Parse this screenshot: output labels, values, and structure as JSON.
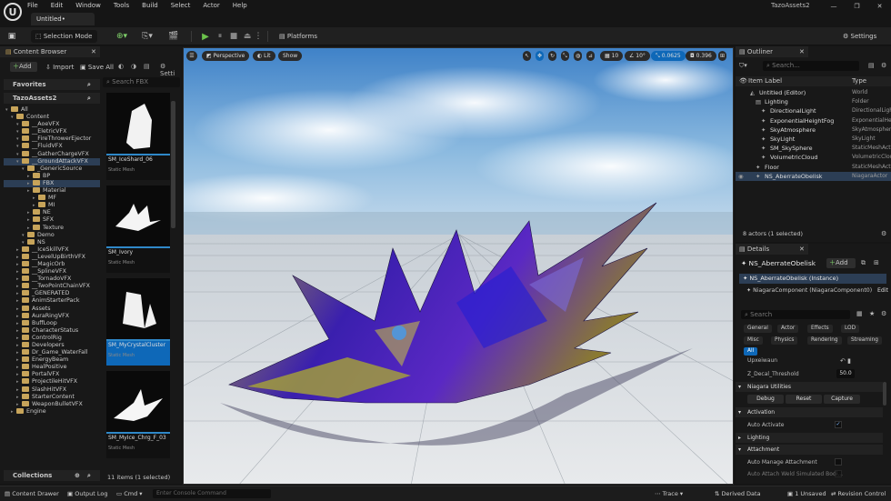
{
  "menu": [
    "File",
    "Edit",
    "Window",
    "Tools",
    "Build",
    "Select",
    "Actor",
    "Help"
  ],
  "level_tab": "Untitled•",
  "project_name": "TazoAssets2",
  "toolbar": {
    "selection_mode": "Selection Mode",
    "platforms": "Platforms",
    "settings": "Settings"
  },
  "content_browser": {
    "tab": "Content Browser",
    "add": "Add",
    "import": "Import",
    "save_all": "Save All",
    "settings_trunc": "Setti",
    "favorites": "Favorites",
    "root": "TazoAssets2",
    "search_placeholder": "Search",
    "search_fbx_placeholder": "Search FBX",
    "tree": [
      {
        "label": "All",
        "depth": 0,
        "state": "none"
      },
      {
        "label": "Content",
        "depth": 1,
        "state": "none"
      },
      {
        "label": "__AoeVFX",
        "depth": 2,
        "state": "none"
      },
      {
        "label": "__EletricVFX",
        "depth": 2,
        "state": "none"
      },
      {
        "label": "__FireThrowerEjector",
        "depth": 2,
        "state": "none"
      },
      {
        "label": "__FluidVFX",
        "depth": 2,
        "state": "none"
      },
      {
        "label": "__GatherChargeVFX",
        "depth": 2,
        "state": "none"
      },
      {
        "label": "__GroundAttackVFX",
        "depth": 2,
        "state": "sel"
      },
      {
        "label": "_GenericSource",
        "depth": 3,
        "state": "none"
      },
      {
        "label": "BP",
        "depth": 4,
        "state": "none"
      },
      {
        "label": "FBX",
        "depth": 4,
        "state": "sel"
      },
      {
        "label": "Material",
        "depth": 4,
        "state": "none"
      },
      {
        "label": "MF",
        "depth": 5,
        "state": "none"
      },
      {
        "label": "MI",
        "depth": 5,
        "state": "none"
      },
      {
        "label": "NE",
        "depth": 4,
        "state": "none"
      },
      {
        "label": "SFX",
        "depth": 4,
        "state": "none"
      },
      {
        "label": "Texture",
        "depth": 4,
        "state": "none"
      },
      {
        "label": "Demo",
        "depth": 3,
        "state": "none"
      },
      {
        "label": "NS",
        "depth": 3,
        "state": "none"
      },
      {
        "label": "__IceSkillVFX",
        "depth": 2,
        "state": "none"
      },
      {
        "label": "__LevelUpBirthVFX",
        "depth": 2,
        "state": "none"
      },
      {
        "label": "__MagicOrb",
        "depth": 2,
        "state": "none"
      },
      {
        "label": "__SplineVFX",
        "depth": 2,
        "state": "none"
      },
      {
        "label": "__TornadoVFX",
        "depth": 2,
        "state": "none"
      },
      {
        "label": "__TwoPointChainVFX",
        "depth": 2,
        "state": "none"
      },
      {
        "label": "_GENERATED",
        "depth": 2,
        "state": "none"
      },
      {
        "label": "AnimStarterPack",
        "depth": 2,
        "state": "none"
      },
      {
        "label": "Assets",
        "depth": 2,
        "state": "none"
      },
      {
        "label": "AuraRingVFX",
        "depth": 2,
        "state": "none"
      },
      {
        "label": "BuffLoop",
        "depth": 2,
        "state": "none"
      },
      {
        "label": "CharacterStatus",
        "depth": 2,
        "state": "none"
      },
      {
        "label": "ControlRig",
        "depth": 2,
        "state": "none"
      },
      {
        "label": "Developers",
        "depth": 2,
        "state": "none"
      },
      {
        "label": "Dr_Game_WaterFall",
        "depth": 2,
        "state": "none"
      },
      {
        "label": "EnergyBeam",
        "depth": 2,
        "state": "none"
      },
      {
        "label": "HealPositive",
        "depth": 2,
        "state": "none"
      },
      {
        "label": "PortalVFX",
        "depth": 2,
        "state": "none"
      },
      {
        "label": "ProjectileHitVFX",
        "depth": 2,
        "state": "none"
      },
      {
        "label": "SlashHitVFX",
        "depth": 2,
        "state": "none"
      },
      {
        "label": "StarterContent",
        "depth": 2,
        "state": "none"
      },
      {
        "label": "WeaponBulletVFX",
        "depth": 2,
        "state": "none"
      },
      {
        "label": "Engine",
        "depth": 1,
        "state": "none"
      }
    ],
    "assets": [
      {
        "name": "SM_IceShard_06",
        "type": "Static Mesh",
        "selected": false
      },
      {
        "name": "SM_Ivory",
        "type": "Static Mesh",
        "selected": false
      },
      {
        "name": "SM_MyCrystalCluster",
        "type": "Static Mesh",
        "selected": true
      },
      {
        "name": "SM_MyIce_Chrg_F_03",
        "type": "Static Mesh",
        "selected": false
      }
    ],
    "collections": "Collections",
    "status": "11 items (1 selected)"
  },
  "viewport": {
    "perspective": "Perspective",
    "lit": "Lit",
    "show": "Show",
    "grid_snap": "10",
    "rot_snap": "10°",
    "scale_snap": "0.0625",
    "camera_speed": "0.396"
  },
  "outliner": {
    "tab": "Outliner",
    "search_placeholder": "Search...",
    "col_label": "Item Label",
    "col_type": "Type",
    "rows": [
      {
        "label": "Untitled (Editor)",
        "type": "World",
        "indent": 1,
        "selected": false
      },
      {
        "label": "Lighting",
        "type": "Folder",
        "indent": 2,
        "selected": false
      },
      {
        "label": "DirectionalLight",
        "type": "DirectionalLight",
        "indent": 3,
        "selected": false
      },
      {
        "label": "ExponentialHeightFog",
        "type": "ExponentialHeightFog",
        "indent": 3,
        "selected": false
      },
      {
        "label": "SkyAtmosphere",
        "type": "SkyAtmosphere",
        "indent": 3,
        "selected": false
      },
      {
        "label": "SkyLight",
        "type": "SkyLight",
        "indent": 3,
        "selected": false
      },
      {
        "label": "SM_SkySphere",
        "type": "StaticMeshActor",
        "indent": 3,
        "selected": false
      },
      {
        "label": "VolumetricCloud",
        "type": "VolumetricCloud",
        "indent": 3,
        "selected": false
      },
      {
        "label": "Floor",
        "type": "StaticMeshActor",
        "indent": 2,
        "selected": false
      },
      {
        "label": "NS_AberrateObelisk",
        "type": "NiagaraActor",
        "indent": 2,
        "selected": true
      }
    ],
    "status": "8 actors (1 selected)"
  },
  "details": {
    "tab": "Details",
    "actor_name": "NS_AberrateObelisk",
    "add": "Add",
    "instance": "NS_AberrateObelisk (Instance)",
    "component": "NiagaraComponent (NiagaraComponent0)",
    "edit": "Edit",
    "search_placeholder": "Search",
    "filters": [
      "General",
      "Actor",
      "Effects",
      "LOD",
      "Misc",
      "Physics",
      "Rendering",
      "Streaming",
      "All"
    ],
    "upper_prop": "Upxeiwaun",
    "decal_label": "Z_Decal_Threshold",
    "decal_value": "50.0",
    "section_utilities": "Niagara Utilities",
    "debug": "Debug",
    "reset": "Reset",
    "capture": "Capture",
    "section_activation": "Activation",
    "auto_activate": "Auto Activate",
    "section_lighting": "Lighting",
    "section_attachment": "Attachment",
    "auto_manage": "Auto Manage Attachment",
    "auto_weld": "Auto Attach Weld Simulated Bodi..."
  },
  "bottombar": {
    "content_drawer": "Content Drawer",
    "output_log": "Output Log",
    "cmd": "Cmd",
    "console_placeholder": "Enter Console Command",
    "trace": "Trace",
    "derived_data": "Derived Data",
    "unsaved": "1 Unsaved",
    "revision_control": "Revision Control"
  },
  "colors": {
    "accent": "#0e68b8",
    "folder": "#c7a45a",
    "play": "#6bc24b"
  }
}
